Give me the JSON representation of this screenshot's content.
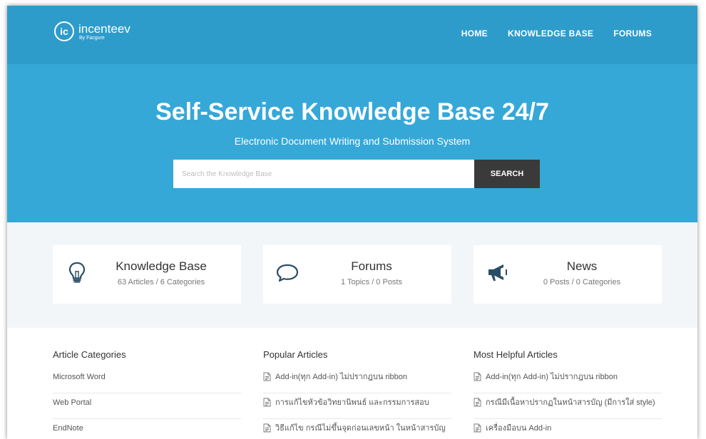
{
  "brand": {
    "mark": "ic",
    "name": "incenteev",
    "byline": "By Facgure"
  },
  "nav": {
    "items": [
      "HOME",
      "KNOWLEDGE BASE",
      "FORUMS"
    ]
  },
  "hero": {
    "title": "Self-Service Knowledge Base 24/7",
    "subtitle": "Electronic Document Writing and Submission System",
    "search_placeholder": "Search the Knowledge Base",
    "search_button": "SEARCH"
  },
  "cards": [
    {
      "icon": "lightbulb-icon",
      "title": "Knowledge Base",
      "meta": "63 Articles / 6 Categories"
    },
    {
      "icon": "speech-bubble-icon",
      "title": "Forums",
      "meta": "1 Topics / 0 Posts"
    },
    {
      "icon": "megaphone-icon",
      "title": "News",
      "meta": "0 Posts / 0 Categories"
    }
  ],
  "article_categories": {
    "heading": "Article Categories",
    "items": [
      "Microsoft Word",
      "Web Portal",
      "EndNote"
    ]
  },
  "popular_articles": {
    "heading": "Popular Articles",
    "items": [
      "Add-in(ทุก Add-in) ไม่ปรากฎบน ribbon",
      "การแก้ไขหัวข้อวิทยานิพนธ์ และกรรมการสอบ",
      "วิธีแก้ไข กรณีไม่ขึ้นจุดก่อนเลขหน้า ในหน้าสารบัญ"
    ]
  },
  "helpful_articles": {
    "heading": "Most Helpful Articles",
    "items": [
      "Add-in(ทุก Add-in) ไม่ปรากฎบน ribbon",
      "กรณีมีเนื้อหาปรากฏในหน้าสารบัญ (มีการใส่ style)",
      "เครื่องมือบน Add-in"
    ]
  },
  "colors": {
    "header": "#2e9ccb",
    "hero": "#35a8d8",
    "button": "#3a3a3a"
  }
}
